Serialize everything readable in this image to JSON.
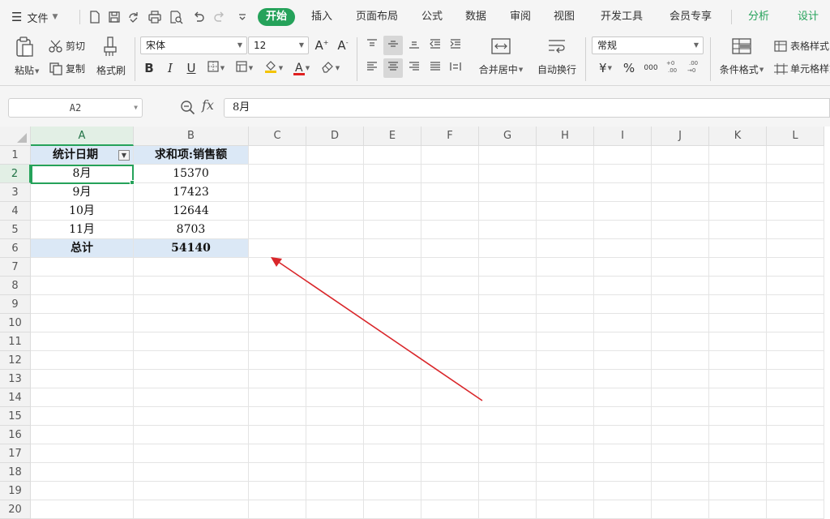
{
  "menubar": {
    "file_label": "文件",
    "tabs": [
      "开始",
      "插入",
      "页面布局",
      "公式",
      "数据",
      "审阅",
      "视图",
      "开发工具",
      "会员专享",
      "分析",
      "设计"
    ],
    "accent_color": "#25a25a"
  },
  "ribbon": {
    "paste": "粘贴",
    "cut": "剪切",
    "copy": "复制",
    "format_painter": "格式刷",
    "font_name": "宋体",
    "font_size": "12",
    "bold": "B",
    "italic": "I",
    "underline": "U",
    "font_color_glyph": "A",
    "merge_center": "合并居中",
    "wrap_text": "自动换行",
    "number_format": "常规",
    "currency": "¥",
    "percent": "%",
    "thousands": "000",
    "conditional_format": "条件格式",
    "table_style": "表格样式",
    "cell_style": "单元格样式"
  },
  "formulabar": {
    "name_box": "A2",
    "fx": "fx",
    "value": "8月"
  },
  "grid": {
    "columns": [
      "A",
      "B",
      "C",
      "D",
      "E",
      "F",
      "G",
      "H",
      "I",
      "J",
      "K",
      "L"
    ],
    "rows": [
      "1",
      "2",
      "3",
      "4",
      "5",
      "6",
      "7",
      "8",
      "9",
      "10",
      "11",
      "12",
      "13",
      "14",
      "15",
      "16",
      "17",
      "18",
      "19",
      "20"
    ],
    "active_cell": "A2"
  },
  "pivot": {
    "header_date": "统计日期",
    "header_sum": "求和项:销售额",
    "rows": [
      {
        "date": "8月",
        "value": "15370"
      },
      {
        "date": "9月",
        "value": "17423"
      },
      {
        "date": "10月",
        "value": "12644"
      },
      {
        "date": "11月",
        "value": "8703"
      }
    ],
    "total_label": "总计",
    "total_value": "54140",
    "highlight_color": "#dbe8f6"
  },
  "annotation": {
    "arrow_color": "#d9262a"
  }
}
